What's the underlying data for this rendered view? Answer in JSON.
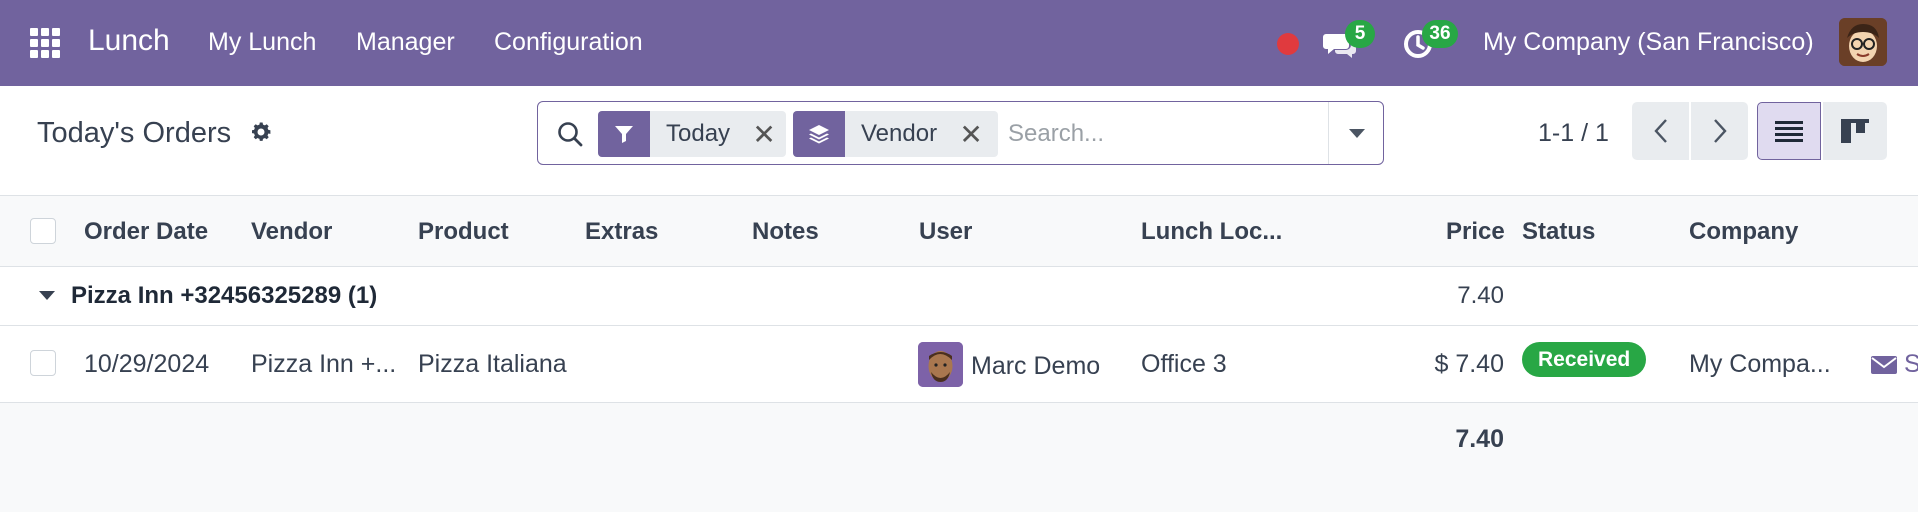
{
  "navbar": {
    "app_name": "Lunch",
    "menu": [
      "My Lunch",
      "Manager",
      "Configuration"
    ],
    "messages_count": "5",
    "activities_count": "36",
    "company": "My Company (San Francisco)",
    "color": "#71639e"
  },
  "control_panel": {
    "title": "Today's Orders",
    "facets": [
      {
        "icon": "filter-icon",
        "label": "Today"
      },
      {
        "icon": "group-by-layers-icon",
        "label": "Vendor"
      }
    ],
    "search_placeholder": "Search...",
    "pager": "1-1 / 1"
  },
  "table": {
    "columns": [
      "Order Date",
      "Vendor",
      "Product",
      "Extras",
      "Notes",
      "User",
      "Lunch Loc...",
      "Price",
      "Status",
      "Company"
    ],
    "group": {
      "label": "Pizza Inn +32456325289 (1)",
      "total": "7.40"
    },
    "rows": [
      {
        "order_date": "10/29/2024",
        "vendor": "Pizza Inn +...",
        "product": "Pizza Italiana",
        "extras": "",
        "notes": "",
        "user": "Marc Demo",
        "lunch_location": "Office 3",
        "price": "$ 7.40",
        "status": "Received",
        "company": "My Compa...",
        "action": "S"
      }
    ],
    "grand_total": "7.40"
  },
  "colors": {
    "accent": "#71639e",
    "success": "#28a745",
    "notification": "#e03a3e"
  }
}
